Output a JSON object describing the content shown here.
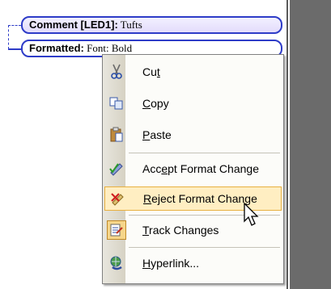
{
  "balloons": [
    {
      "label": "Comment [LED1]:",
      "text": " Tufts"
    },
    {
      "label": "Formatted:",
      "text": " Font: Bold"
    }
  ],
  "menu": {
    "items": [
      {
        "label_pre": "Cu",
        "label_u": "t",
        "label_post": "",
        "icon": "scissors-icon"
      },
      {
        "label_pre": "",
        "label_u": "C",
        "label_post": "opy",
        "icon": "copy-icon"
      },
      {
        "label_pre": "",
        "label_u": "P",
        "label_post": "aste",
        "icon": "paste-icon"
      },
      {
        "label_pre": "Acc",
        "label_u": "e",
        "label_post": "pt Format Change",
        "icon": "accept-change-icon"
      },
      {
        "label_pre": "",
        "label_u": "R",
        "label_post": "eject Format Change",
        "icon": "reject-change-icon",
        "highlighted": true
      },
      {
        "label_pre": "",
        "label_u": "T",
        "label_post": "rack Changes",
        "icon": "track-changes-icon",
        "checked": true
      },
      {
        "label_pre": "",
        "label_u": "H",
        "label_post": "yperlink...",
        "icon": "hyperlink-icon"
      }
    ]
  }
}
